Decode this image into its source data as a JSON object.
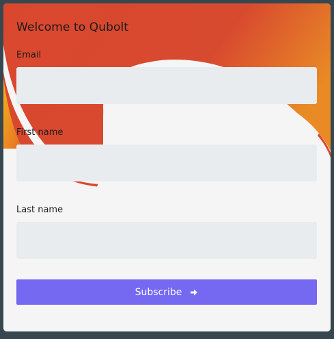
{
  "form": {
    "title": "Welcome to Qubolt",
    "fields": [
      {
        "label": "Email",
        "value": "",
        "placeholder": ""
      },
      {
        "label": "First name",
        "value": "",
        "placeholder": ""
      },
      {
        "label": "Last name",
        "value": "",
        "placeholder": ""
      }
    ],
    "submit_label": "Subscribe",
    "submit_icon": "arrow-right-icon"
  },
  "colors": {
    "page_background": "#37474f",
    "card_background": "#f5f5f5",
    "input_background": "#e8ecee",
    "button_background": "#7469f0",
    "accent_red": "#d9472f",
    "accent_orange": "#e98a25",
    "accent_yellow": "#f2b31c"
  }
}
